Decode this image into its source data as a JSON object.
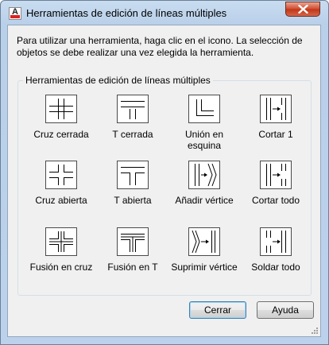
{
  "window": {
    "title": "Herramientas de edición de líneas múltiples",
    "icon_letter": "A",
    "close_icon": "close-icon"
  },
  "instructions": "Para utilizar una herramienta, haga clic en el icono. La selección de objetos se debe realizar una vez elegida la herramienta.",
  "group": {
    "label": "Herramientas de edición de líneas múltiples",
    "tools": [
      {
        "label": "Cruz cerrada",
        "icon": "closed-cross-icon"
      },
      {
        "label": "T cerrada",
        "icon": "closed-tee-icon"
      },
      {
        "label": "Unión en esquina",
        "icon": "corner-joint-icon"
      },
      {
        "label": "Cortar 1",
        "icon": "cut-single-icon"
      },
      {
        "label": "Cruz abierta",
        "icon": "open-cross-icon"
      },
      {
        "label": "T abierta",
        "icon": "open-tee-icon"
      },
      {
        "label": "Añadir vértice",
        "icon": "add-vertex-icon"
      },
      {
        "label": "Cortar todo",
        "icon": "cut-all-icon"
      },
      {
        "label": "Fusión en cruz",
        "icon": "merged-cross-icon"
      },
      {
        "label": "Fusión en T",
        "icon": "merged-tee-icon"
      },
      {
        "label": "Suprimir vértice",
        "icon": "delete-vertex-icon"
      },
      {
        "label": "Soldar todo",
        "icon": "weld-all-icon"
      }
    ]
  },
  "buttons": {
    "close": "Cerrar",
    "help": "Ayuda"
  }
}
